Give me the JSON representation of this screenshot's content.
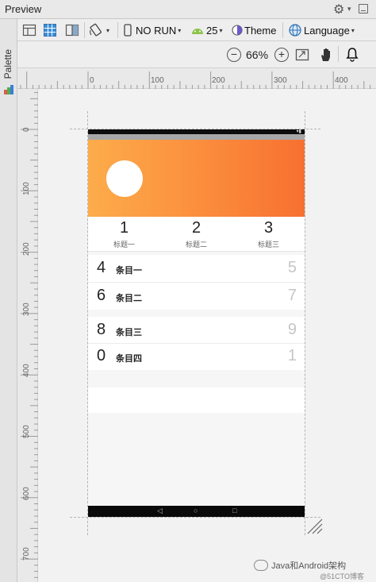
{
  "window": {
    "title": "Preview",
    "palette_label": "Palette"
  },
  "toolbar": {
    "device_label": "NO RUN",
    "api_label": "25",
    "theme_label": "Theme",
    "language_label": "Language"
  },
  "zoom": {
    "level_label": "66%"
  },
  "rulers": {
    "horizontal": [
      "0",
      "100",
      "200",
      "300",
      "400"
    ],
    "vertical": [
      "0",
      "100",
      "200",
      "300",
      "400",
      "500",
      "600",
      "700"
    ]
  },
  "device_screen": {
    "stats": [
      {
        "number": "1",
        "label": "标题一"
      },
      {
        "number": "2",
        "label": "标题二"
      },
      {
        "number": "3",
        "label": "标题三"
      }
    ],
    "group1": [
      {
        "left": "4",
        "text": "条目一",
        "right": "5"
      },
      {
        "left": "6",
        "text": "条目二",
        "right": "7"
      }
    ],
    "group2": [
      {
        "left": "8",
        "text": "条目三",
        "right": "9"
      },
      {
        "left": "0",
        "text": "条目四",
        "right": "1"
      }
    ]
  },
  "watermark": {
    "text": "Java和Android架构",
    "subtext": "@51CTO博客"
  },
  "colors": {
    "header_gradient_start": "#fdac4b",
    "header_gradient_end": "#f77030"
  }
}
